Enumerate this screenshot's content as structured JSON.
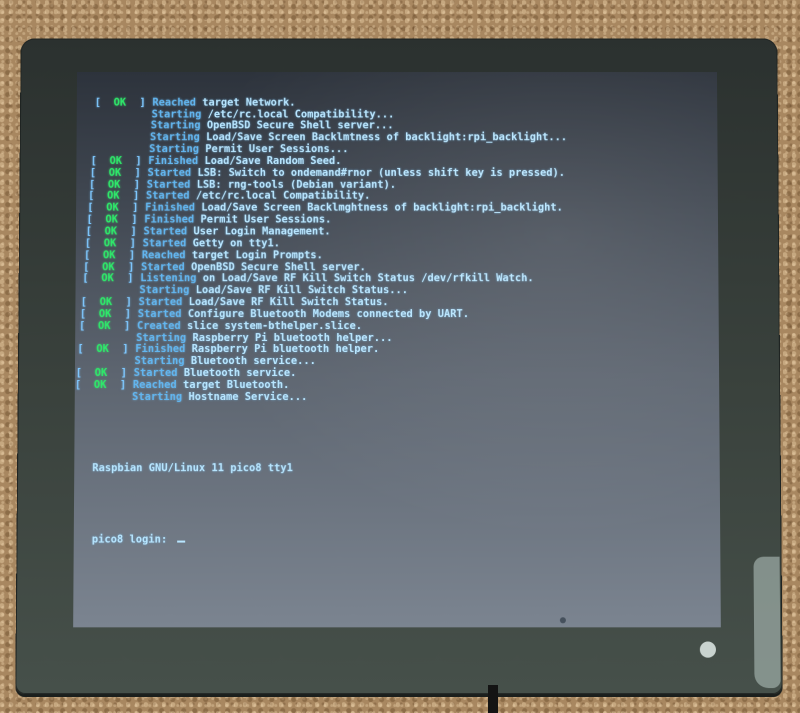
{
  "scene": {
    "description": "Photo of a square LCD panel showing a Raspberry Pi boot console",
    "colors": {
      "ok": "#2ee86a",
      "text": "#b8e6ff",
      "verb": "#62b6f0",
      "bezel": "#2b312f",
      "surface": "#a88760"
    }
  },
  "console": {
    "lines": [
      {
        "status": "OK",
        "verb": "Reached",
        "text": "target Network."
      },
      {
        "status": "",
        "verb": "Starting",
        "text": "/etc/rc.local Compatibility..."
      },
      {
        "status": "",
        "verb": "Starting",
        "text": "OpenBSD Secure Shell server..."
      },
      {
        "status": "",
        "verb": "Starting",
        "text": "Load/Save Screen Backlmtness of backlight:rpi_backlight..."
      },
      {
        "status": "",
        "verb": "Starting",
        "text": "Permit User Sessions..."
      },
      {
        "status": "OK",
        "verb": "Finished",
        "text": "Load/Save Random Seed."
      },
      {
        "status": "OK",
        "verb": "Started",
        "text": "LSB: Switch to ondemand#rnor (unless shift key is pressed)."
      },
      {
        "status": "OK",
        "verb": "Started",
        "text": "LSB: rng-tools (Debian variant)."
      },
      {
        "status": "OK",
        "verb": "Started",
        "text": "/etc/rc.local Compatibility."
      },
      {
        "status": "OK",
        "verb": "Finished",
        "text": "Load/Save Screen Backlmghtness of backlight:rpi_backlight."
      },
      {
        "status": "OK",
        "verb": "Finished",
        "text": "Permit User Sessions."
      },
      {
        "status": "OK",
        "verb": "Started",
        "text": "User Login Management."
      },
      {
        "status": "OK",
        "verb": "Started",
        "text": "Getty on tty1."
      },
      {
        "status": "OK",
        "verb": "Reached",
        "text": "target Login Prompts."
      },
      {
        "status": "OK",
        "verb": "Started",
        "text": "OpenBSD Secure Shell server."
      },
      {
        "status": "OK",
        "verb": "Listening",
        "text": "on Load/Save RF Kill Switch Status /dev/rfkill Watch."
      },
      {
        "status": "",
        "verb": "Starting",
        "text": "Load/Save RF Kill Switch Status..."
      },
      {
        "status": "OK",
        "verb": "Started",
        "text": "Load/Save RF Kill Switch Status."
      },
      {
        "status": "OK",
        "verb": "Started",
        "text": "Configure Bluetooth Modems connected by UART."
      },
      {
        "status": "OK",
        "verb": "Created",
        "text": "slice system-bthelper.slice."
      },
      {
        "status": "",
        "verb": "Starting",
        "text": "Raspberry Pi bluetooth helper..."
      },
      {
        "status": "OK",
        "verb": "Finished",
        "text": "Raspberry Pi bluetooth helper."
      },
      {
        "status": "",
        "verb": "Starting",
        "text": "Bluetooth service..."
      },
      {
        "status": "OK",
        "verb": "Started",
        "text": "Bluetooth service."
      },
      {
        "status": "OK",
        "verb": "Reached",
        "text": "target Bluetooth."
      },
      {
        "status": "",
        "verb": "Starting",
        "text": "Hostname Service..."
      }
    ],
    "banner": "Raspbian GNU/Linux 11 pico8 tty1",
    "login_prompt": "pico8 login: ",
    "login_value": ""
  }
}
